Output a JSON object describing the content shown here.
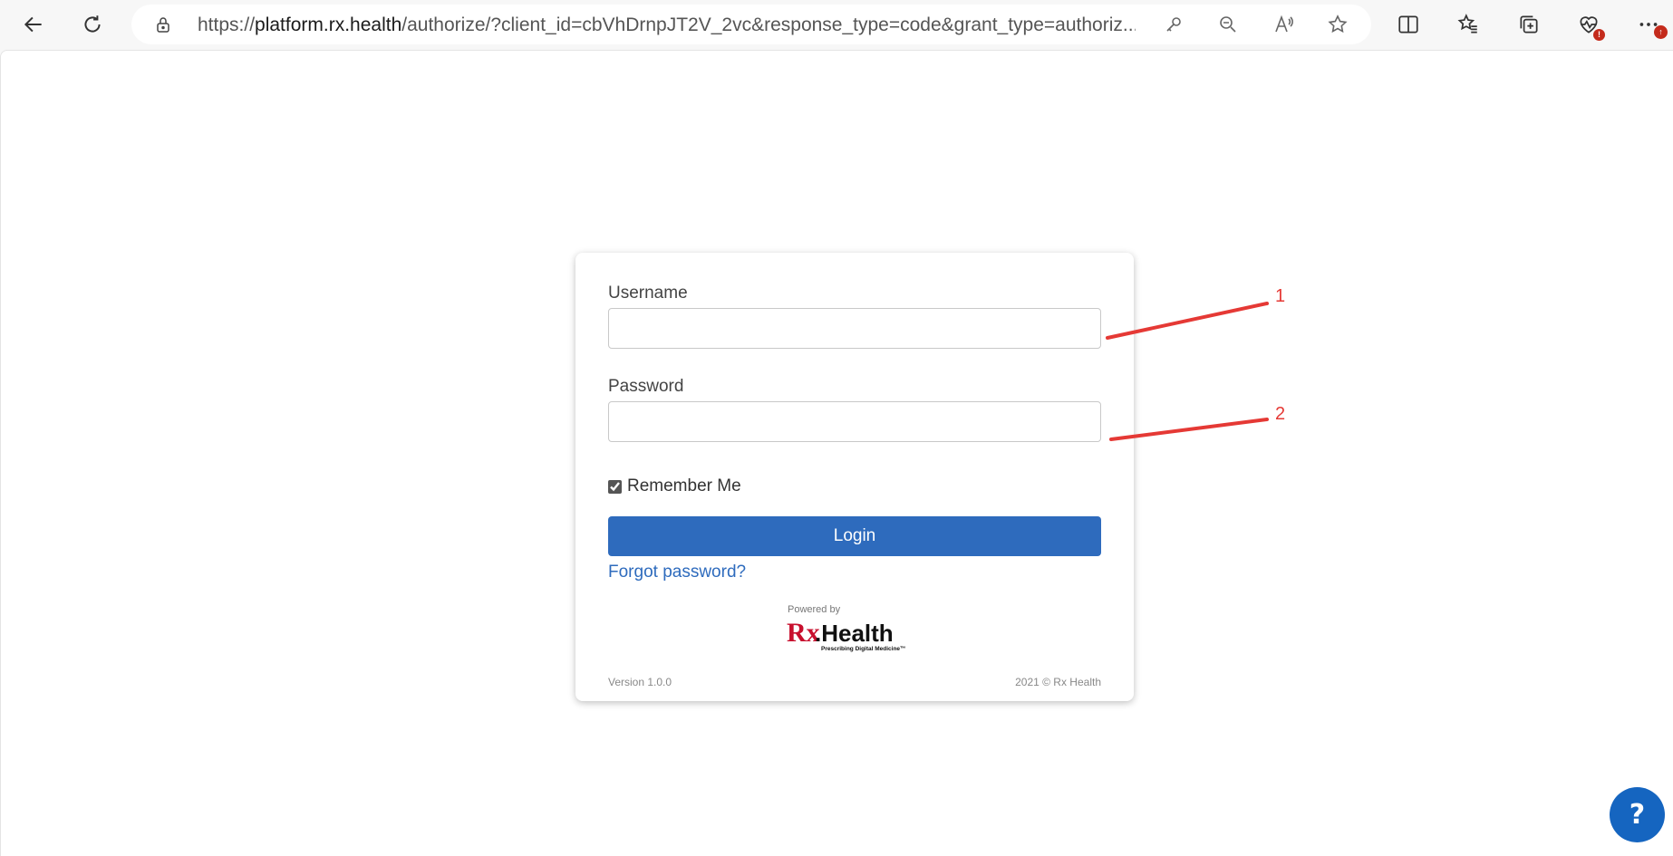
{
  "browser": {
    "url_prefix": "https://",
    "url_host": "platform.rx.health",
    "url_path": "/authorize/?client_id=cbVhDrnpJT2V_2vc&response_type=code&grant_type=authoriz...",
    "icons": [
      "back-icon",
      "refresh-icon",
      "lock-icon",
      "key-icon",
      "zoom-out-icon",
      "read-aloud-icon",
      "star-icon",
      "split-screen-icon",
      "favorites-icon",
      "collections-icon",
      "health-icon",
      "more-icon"
    ],
    "health_badge": "!",
    "more_badge": "↑"
  },
  "login": {
    "username_label": "Username",
    "username_value": "",
    "password_label": "Password",
    "password_value": "",
    "remember_label": "Remember Me",
    "remember_checked": true,
    "login_button": "Login",
    "forgot_link": "Forgot password?",
    "powered_by": "Powered by",
    "logo_rx": "Rx",
    "logo_health": ".Health",
    "logo_tagline": "Prescribing Digital Medicine™",
    "version": "Version 1.0.0",
    "copyright": "2021 © Rx Health"
  },
  "annotations": [
    {
      "label": "1"
    },
    {
      "label": "2"
    }
  ],
  "help_button": "?",
  "colors": {
    "primary": "#2e6bbd",
    "annotation": "#e53935",
    "help": "#1565c0",
    "logo_red": "#c8102e"
  }
}
